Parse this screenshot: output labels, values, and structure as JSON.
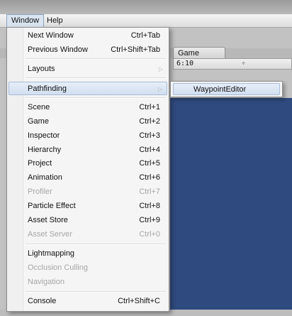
{
  "menubar": {
    "window_label": "Window",
    "help_label": "Help"
  },
  "editor": {
    "game_tab_label": "Game",
    "aspect_value": "6:10",
    "aspect_arrow": "÷"
  },
  "menu": {
    "items": [
      {
        "label": "Next Window",
        "shortcut": "Ctrl+Tab"
      },
      {
        "label": "Previous Window",
        "shortcut": "Ctrl+Shift+Tab"
      },
      {
        "label": "Layouts",
        "shortcut": ""
      },
      {
        "label": "Pathfinding",
        "shortcut": ""
      },
      {
        "label": "Scene",
        "shortcut": "Ctrl+1"
      },
      {
        "label": "Game",
        "shortcut": "Ctrl+2"
      },
      {
        "label": "Inspector",
        "shortcut": "Ctrl+3"
      },
      {
        "label": "Hierarchy",
        "shortcut": "Ctrl+4"
      },
      {
        "label": "Project",
        "shortcut": "Ctrl+5"
      },
      {
        "label": "Animation",
        "shortcut": "Ctrl+6"
      },
      {
        "label": "Profiler",
        "shortcut": "Ctrl+7"
      },
      {
        "label": "Particle Effect",
        "shortcut": "Ctrl+8"
      },
      {
        "label": "Asset Store",
        "shortcut": "Ctrl+9"
      },
      {
        "label": "Asset Server",
        "shortcut": "Ctrl+0"
      },
      {
        "label": "Lightmapping",
        "shortcut": ""
      },
      {
        "label": "Occlusion Culling",
        "shortcut": ""
      },
      {
        "label": "Navigation",
        "shortcut": ""
      },
      {
        "label": "Console",
        "shortcut": "Ctrl+Shift+C"
      }
    ],
    "submenu_arrow": "▷"
  },
  "submenu": {
    "items": [
      {
        "label": "WaypointEditor"
      }
    ]
  }
}
